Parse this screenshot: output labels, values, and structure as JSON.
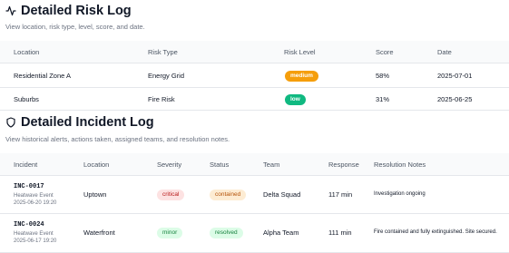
{
  "risk_log": {
    "title": "Detailed Risk Log",
    "description": "View location, risk type, level, score, and date.",
    "columns": [
      "Location",
      "Risk Type",
      "Risk Level",
      "Score",
      "Date"
    ],
    "rows": [
      {
        "location": "Residential Zone A",
        "risk_type": "Energy Grid",
        "risk_level": "medium",
        "score": "58%",
        "date": "2025-07-01"
      },
      {
        "location": "Suburbs",
        "risk_type": "Fire Risk",
        "risk_level": "low",
        "score": "31%",
        "date": "2025-06-25"
      }
    ]
  },
  "incident_log": {
    "title": "Detailed Incident Log",
    "description": "View historical alerts, actions taken, assigned teams, and resolution notes.",
    "columns": [
      "Incident",
      "Location",
      "Severity",
      "Status",
      "Team",
      "Response",
      "Resolution Notes"
    ],
    "rows": [
      {
        "id": "INC-0017",
        "event": "Heatwave Event",
        "timestamp": "2025-06-20 19:20",
        "location": "Uptown",
        "severity": "critical",
        "status": "contained",
        "team": "Delta Squad",
        "response": "117 min",
        "notes": "Investigation ongoing"
      },
      {
        "id": "INC-0024",
        "event": "Heatwave Event",
        "timestamp": "2025-06-17 19:20",
        "location": "Waterfront",
        "severity": "minor",
        "status": "resolved",
        "team": "Alpha Team",
        "response": "111 min",
        "notes": "Fire contained and fully extinguished. Site secured."
      }
    ]
  },
  "colors": {
    "medium": "#f59e0b",
    "low": "#10b981",
    "critical_bg": "#fde2e2",
    "minor_bg": "#dcfce7"
  },
  "icons": {
    "risk_log": "activity-pulse-icon",
    "incident_log": "shield-icon"
  }
}
